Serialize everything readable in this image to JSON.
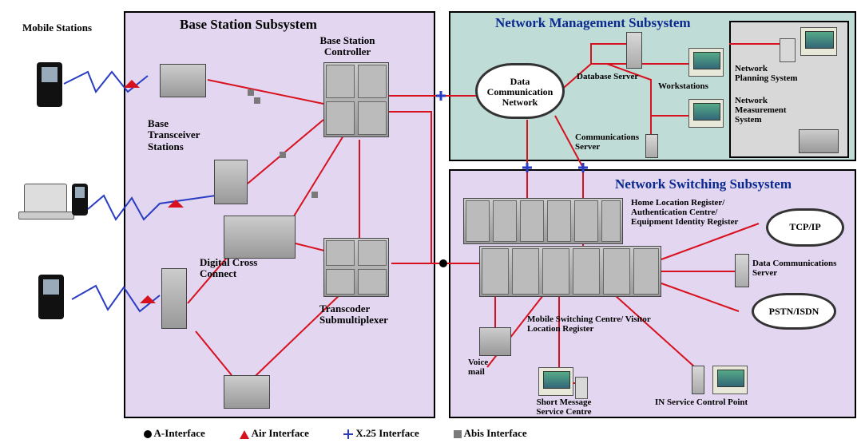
{
  "title_ms": "Mobile Stations",
  "bss": {
    "title": "Base Station Subsystem",
    "bsc": "Base Station Controller",
    "bts": "Base Transceiver Stations",
    "dcc": "Digital Cross Connect",
    "tsm": "Transcoder Submultiplexer"
  },
  "nms": {
    "title": "Network Management Subsystem",
    "dcn": "Data Communication Network",
    "db": "Database Server",
    "ws": "Workstations",
    "cs": "Communications Server",
    "nps": "Network Planning System",
    "nms2": "Network Measurement System"
  },
  "nss": {
    "title": "Network Switching Subsystem",
    "hlr": "Home Location Register/ Authentication Centre/ Equipment Identity Register",
    "tcpip": "TCP/IP",
    "dcs": "Data Communications Server",
    "pstn": "PSTN/ISDN",
    "msc": "Mobile Switching Centre/ Visitor Location Register",
    "vm": "Voice mail",
    "sms": "Short Message Service Centre",
    "in": "IN Service Control Point"
  },
  "legend": {
    "a": "A-Interface",
    "air": "Air Interface",
    "x25": "X.25 Interface",
    "abis": "Abis Interface"
  }
}
